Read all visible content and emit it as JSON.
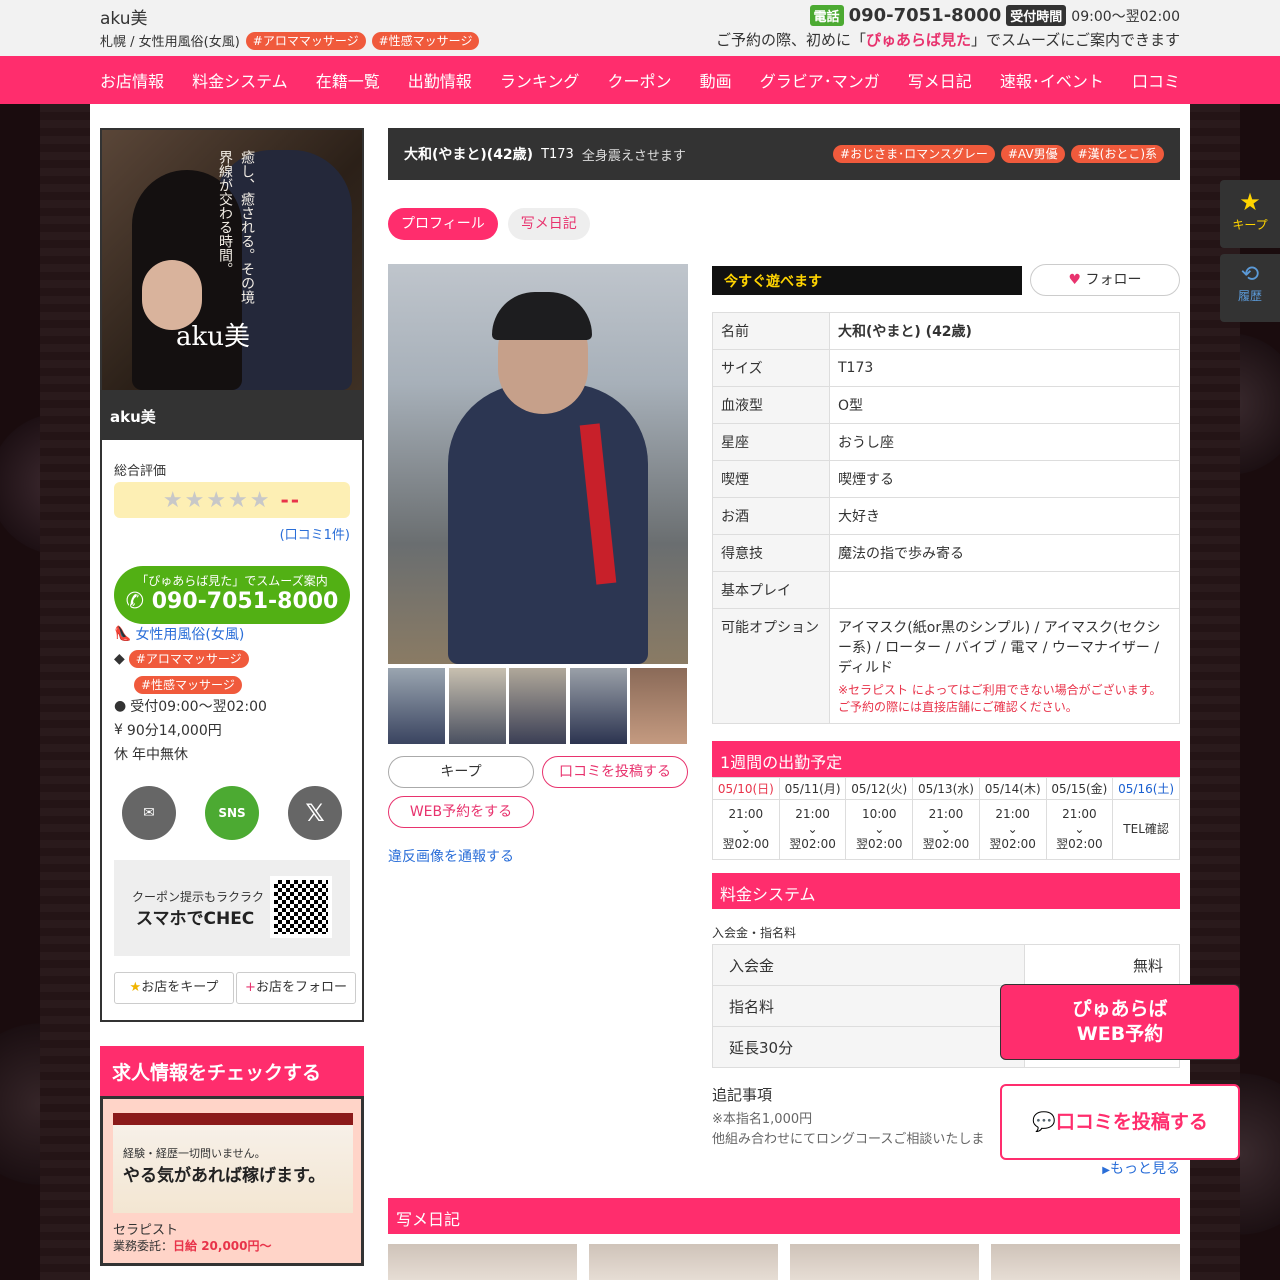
{
  "header": {
    "logo": "aku美",
    "subtitle": "札幌 / 女性用風俗(女風)",
    "tags": [
      "#アロママッサージ",
      "#性感マッサージ"
    ],
    "tel_label": "電話",
    "tel": "090-7051-8000",
    "hours_label": "受付時間",
    "hours": "09:00〜翌02:00",
    "notice_pre": "ご予約の際、初めに「",
    "notice_bold": "ぴゅあらば見た",
    "notice_post": "」でスムーズにご案内できます"
  },
  "nav": [
    "お店情報",
    "料金システム",
    "在籍一覧",
    "出勤情報",
    "ランキング",
    "クーポン",
    "動画",
    "グラビア･マンガ",
    "写メ日記",
    "速報･イベント",
    "口コミ"
  ],
  "sidebar": {
    "hero_text": "癒し、癒される。その境界線が交わる時間。",
    "brand": "aku美",
    "shop_name": "aku美",
    "rating_label": "総合評価",
    "stars": "★★★★★",
    "rating_value": "--",
    "review_link": "(口コミ1件)",
    "call_note": "「ぴゅあらば見た」でスムーズ案内",
    "call_tel": "090-7051-8000",
    "genre": "女性用風俗(女風)",
    "tags": [
      "#アロママッサージ",
      "#性感マッサージ"
    ],
    "hours": "受付09:00〜翌02:00",
    "price": "90分14,000円",
    "holiday": "年中無休",
    "qr_text1": "クーポン提示もラクラク",
    "qr_text2": "スマホでCHEC",
    "keep_btn": "お店をキープ",
    "follow_btn": "お店をフォロー"
  },
  "recruit": {
    "heading": "求人情報をチェックする",
    "img_line1": "経験・経歴一切問いません。",
    "img_line2": "やる気があれば稼げます。",
    "role": "セラピスト",
    "pay_label": "業務委託：",
    "pay": "日給 20,000円〜"
  },
  "therapist": {
    "name": "大和(やまと)(42歳)",
    "size": "T173",
    "comment": "全身震えさせます",
    "tags": [
      "#おじさま･ロマンスグレー",
      "#AV男優",
      "#漢(おとこ)系"
    ]
  },
  "tabs": [
    "プロフィール",
    "写メ日記"
  ],
  "actions": {
    "keep": "キープ",
    "review": "口コミを投稿する",
    "web": "WEB予約をする",
    "report": "違反画像を通報する"
  },
  "status": {
    "now": "今すぐ遊べます",
    "follow": "フォロー"
  },
  "profile": [
    {
      "k": "名前",
      "v": "大和(やまと) (42歳)"
    },
    {
      "k": "サイズ",
      "v": "T173"
    },
    {
      "k": "血液型",
      "v": "O型"
    },
    {
      "k": "星座",
      "v": "おうし座"
    },
    {
      "k": "喫煙",
      "v": "喫煙する"
    },
    {
      "k": "お酒",
      "v": "大好き"
    },
    {
      "k": "得意技",
      "v": "魔法の指で歩み寄る"
    },
    {
      "k": "基本プレイ",
      "v": ""
    },
    {
      "k": "可能オプション",
      "v": "アイマスク(紙or黒のシンプル) / アイマスク(セクシー系) / ローター / バイブ / 電マ / ウーマナイザー / ディルド"
    }
  ],
  "option_warn": "※セラピスト によってはご利用できない場合がございます。ご予約の際には直接店舗にご確認ください。",
  "schedule": {
    "heading": "1週間の出勤予定",
    "days": [
      "05/10(日)",
      "05/11(月)",
      "05/12(火)",
      "05/13(水)",
      "05/14(木)",
      "05/15(金)",
      "05/16(土)"
    ],
    "start": [
      "21:00",
      "21:00",
      "10:00",
      "21:00",
      "21:00",
      "21:00",
      "TEL確認"
    ],
    "end": [
      "翌02:00",
      "翌02:00",
      "翌02:00",
      "翌02:00",
      "翌02:00",
      "翌02:00",
      ""
    ]
  },
  "fees": {
    "heading": "料金システム",
    "caption": "入会金・指名料",
    "rows": [
      {
        "k": "入会金",
        "v": "無料"
      },
      {
        "k": "指名料",
        "v": ""
      },
      {
        "k": "延長30分",
        "v": ""
      }
    ],
    "note_heading": "追記事項",
    "note1": "※本指名1,000円",
    "note2": "他組み合わせにてロングコースご相談いたしま",
    "more": "もっと見る"
  },
  "diary": {
    "heading": "写メ日記"
  },
  "float": {
    "keep": "キープ",
    "history": "履歴",
    "web1": "ぴゅあらば",
    "web2": "WEB予約",
    "review": "口コミを投稿する"
  },
  "colors": {
    "accent": "#ff2d6d",
    "call": "#52b014"
  }
}
